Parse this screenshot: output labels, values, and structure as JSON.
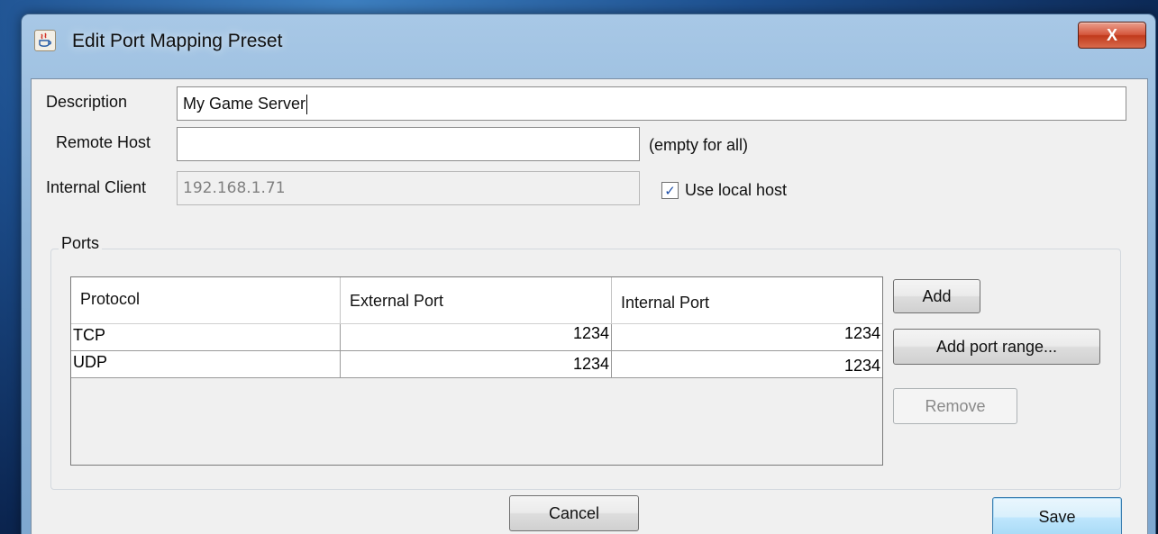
{
  "window": {
    "title": "Edit Port Mapping Preset",
    "close_glyph": "X"
  },
  "form": {
    "description_label": "Description",
    "description_value": "My Game Server",
    "remote_host_label": "Remote Host",
    "remote_host_value": "",
    "remote_host_hint": "(empty for all)",
    "internal_client_label": "Internal Client",
    "internal_client_value": "192.168.1.71",
    "use_local_host_label": "Use local host",
    "use_local_host_checked": true
  },
  "ports": {
    "group_label": "Ports",
    "columns": [
      "Protocol",
      "External Port",
      "Internal Port"
    ],
    "rows": [
      {
        "protocol": "TCP",
        "external": "1234",
        "internal": "1234"
      },
      {
        "protocol": "UDP",
        "external": "1234",
        "internal": "1234"
      }
    ],
    "buttons": {
      "add": "Add",
      "add_range": "Add port range...",
      "remove": "Remove"
    }
  },
  "footer": {
    "cancel": "Cancel",
    "save": "Save"
  },
  "icons": {
    "app": "java-coffee-cup-icon",
    "checkbox": "checkmark-icon",
    "close": "close-icon"
  }
}
